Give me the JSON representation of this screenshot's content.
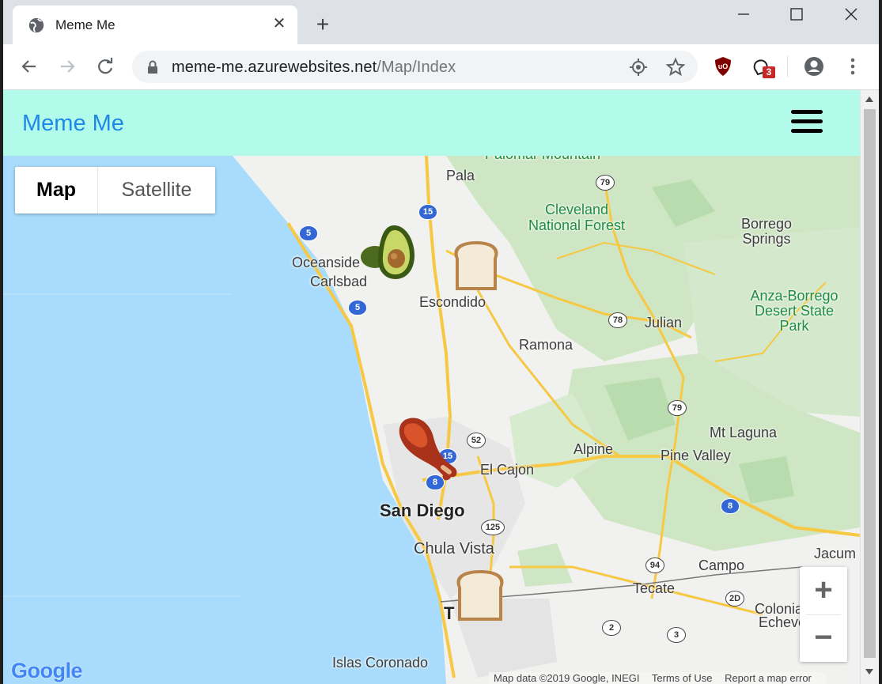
{
  "browser": {
    "tab_title": "Meme Me",
    "tab_icon": "globe-icon",
    "url_host": "meme-me.azurewebsites.net",
    "url_path": "/Map/Index",
    "extension_badge": "3"
  },
  "page": {
    "brand": "Meme Me",
    "menu_icon": "hamburger-icon",
    "colors": {
      "navbar": "#b2fbea",
      "brand": "#1e88e5",
      "water": "#a9dcfc"
    }
  },
  "map": {
    "type_buttons": {
      "map": "Map",
      "satellite": "Satellite"
    },
    "zoom": {
      "in": "+",
      "out": "−"
    },
    "google_logo": "Google",
    "attribution": {
      "data": "Map data ©2019 Google, INEGI",
      "terms": "Terms of Use",
      "report": "Report a map error"
    },
    "places": {
      "palomar": "Palomar Mountain",
      "pala": "Pala",
      "cleveland": "Cleveland National Forest",
      "borrego": "Borrego Springs",
      "oceanside": "Oceanside",
      "carlsbad": "Carlsbad",
      "escondido": "Escondido",
      "anza": "Anza-Borrego Desert State Park",
      "julian": "Julian",
      "ramona": "Ramona",
      "mt_laguna": "Mt Laguna",
      "alpine": "Alpine",
      "pine_valley": "Pine Valley",
      "el_cajon": "El Cajon",
      "san_diego": "San Diego",
      "chula_vista": "Chula Vista",
      "campo": "Campo",
      "tecate": "Tecate",
      "jacumba": "Jacum",
      "colonia": "Colonia",
      "echeve": "Echeve",
      "islas": "Islas Coronado",
      "tijuana_t": "T"
    },
    "shields": {
      "i5a": "5",
      "i5b": "5",
      "i15a": "15",
      "i15b": "15",
      "i8a": "8",
      "i8b": "8",
      "sr79a": "79",
      "sr78": "78",
      "sr79b": "79",
      "sr52": "52",
      "sr125": "125",
      "sr94": "94",
      "mx2d": "2D",
      "mx2": "2",
      "mx3": "3"
    },
    "markers": [
      "avocado",
      "bread",
      "chicken-drumstick",
      "bread"
    ]
  }
}
